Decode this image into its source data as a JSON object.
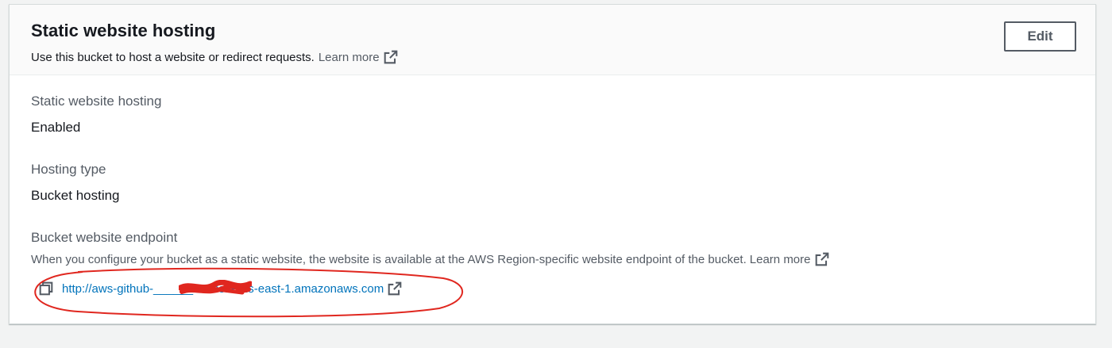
{
  "panel": {
    "title": "Static website hosting",
    "description": "Use this bucket to host a website or redirect requests.",
    "learn_more": "Learn more",
    "edit_label": "Edit"
  },
  "fields": {
    "hosting_label": "Static website hosting",
    "hosting_value": "Enabled",
    "type_label": "Hosting type",
    "type_value": "Bucket hosting",
    "endpoint_label": "Bucket website endpoint",
    "endpoint_desc": "When you configure your bucket as a static website, the website is available at the AWS Region-specific website endpoint of the bucket.",
    "endpoint_learn_more": "Learn more",
    "endpoint_url": "http://aws-github-______-website-us-east-1.amazonaws.com"
  },
  "icons": {
    "external": "external-link-icon",
    "copy": "copy-icon"
  },
  "colors": {
    "annotation_red": "#e0271f",
    "link": "#545b64",
    "text": "#16191f"
  }
}
